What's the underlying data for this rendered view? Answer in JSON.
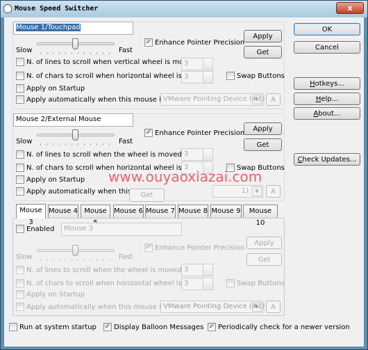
{
  "window": {
    "title": "Mouse Speed Switcher",
    "close": "x"
  },
  "common": {
    "slow": "Slow",
    "fast": "Fast",
    "apply": "Apply",
    "get": "Get",
    "enhance": "Enhance Pointer Precision",
    "swap": "Swap Buttons",
    "apply_startup": "Apply on Startup",
    "a_button": "A"
  },
  "mouse1": {
    "name": "Mouse 1/Touchpad",
    "slider_value_fraction": 0.5,
    "enhance_checked": true,
    "lines_label": "N. of lines to scroll when vertical wheel is moved:",
    "lines_value": "3",
    "chars_label": "N. of chars to scroll when  horizontal wheel is moved:",
    "chars_value": "3",
    "auto_label": "Apply automatically when this mouse is used:",
    "device": "VMware Pointing Device (#1)"
  },
  "mouse2": {
    "name": "Mouse 2/External Mouse",
    "slider_value_fraction": 0.5,
    "enhance_checked": true,
    "lines_label": "N. of lines to scroll when the wheel is moved:",
    "lines_value": "3",
    "chars_label": "N. of chars to scroll when  horizontal wheel is moved:",
    "chars_value": "3",
    "auto_label": "Apply automatically when this mous",
    "device_partial": "1)",
    "overlay_get": "Get"
  },
  "tabs": [
    "Mouse 3",
    "Mouse 4",
    "Mouse 5",
    "Mouse 6",
    "Mouse 7",
    "Mouse 8",
    "Mouse 9",
    "Mouse 10"
  ],
  "mouse3": {
    "enabled_label": "Enabled",
    "name": "Mouse 3",
    "lines_label": "N. of lines to scroll when the wheel is moved:",
    "lines_value": "3",
    "chars_label": "N. of chars to scroll when  horizontal wheel is moved:",
    "chars_value": "3",
    "auto_label": "Apply automatically when this mouse is used:",
    "device": "VMware Pointing Device (#1)"
  },
  "side": {
    "ok": "OK",
    "cancel": "Cancel",
    "hotkeys_u": "H",
    "hotkeys": "otkeys...",
    "help_u": "H",
    "help": "elp...",
    "about_u": "A",
    "about": "bout...",
    "check_u": "C",
    "check": "heck Updates..."
  },
  "bottom": {
    "run": "Run at system startup",
    "run_checked": false,
    "balloon": "Display Balloon Messages",
    "balloon_checked": true,
    "periodic": "Periodically check for a newer version",
    "periodic_checked": true
  },
  "watermark": "www.ouyaoxiazai.com"
}
